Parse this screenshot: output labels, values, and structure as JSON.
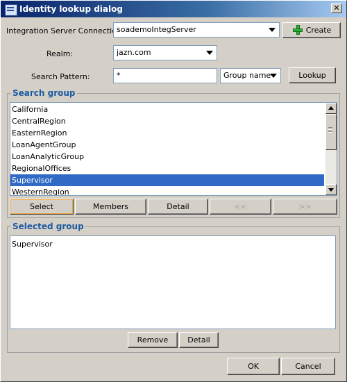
{
  "window": {
    "title": "Identity lookup dialog",
    "close": "✕"
  },
  "form": {
    "connection_label": "Integration Server Connection",
    "connection_value": "soademoIntegServer",
    "create_label": "Create",
    "realm_label": "Realm:",
    "realm_value": "jazn.com",
    "pattern_label": "Search Pattern:",
    "pattern_value": "*",
    "search_type": "Group name",
    "lookup_label": "Lookup"
  },
  "search_group": {
    "title": "Search group",
    "items": [
      "California",
      "CentralRegion",
      "EasternRegion",
      "LoanAgentGroup",
      "LoanAnalyticGroup",
      "RegionalOffices",
      "Supervisor",
      "WesternRegion"
    ],
    "selected": "Supervisor",
    "buttons": {
      "select": "Select",
      "members": "Members",
      "detail": "Detail",
      "prev": "<<",
      "next": ">>"
    }
  },
  "selected_group": {
    "title": "Selected group",
    "items": [
      "Supervisor"
    ],
    "buttons": {
      "remove": "Remove",
      "detail": "Detail"
    }
  },
  "footer": {
    "ok": "OK",
    "cancel": "Cancel"
  },
  "colors": {
    "title_start": "#0a246a",
    "selection": "#316ac5",
    "group_label": "#1e5aa0"
  },
  "icons": {
    "window": "dialog-icon",
    "create": "plus-icon",
    "close": "close-icon"
  }
}
